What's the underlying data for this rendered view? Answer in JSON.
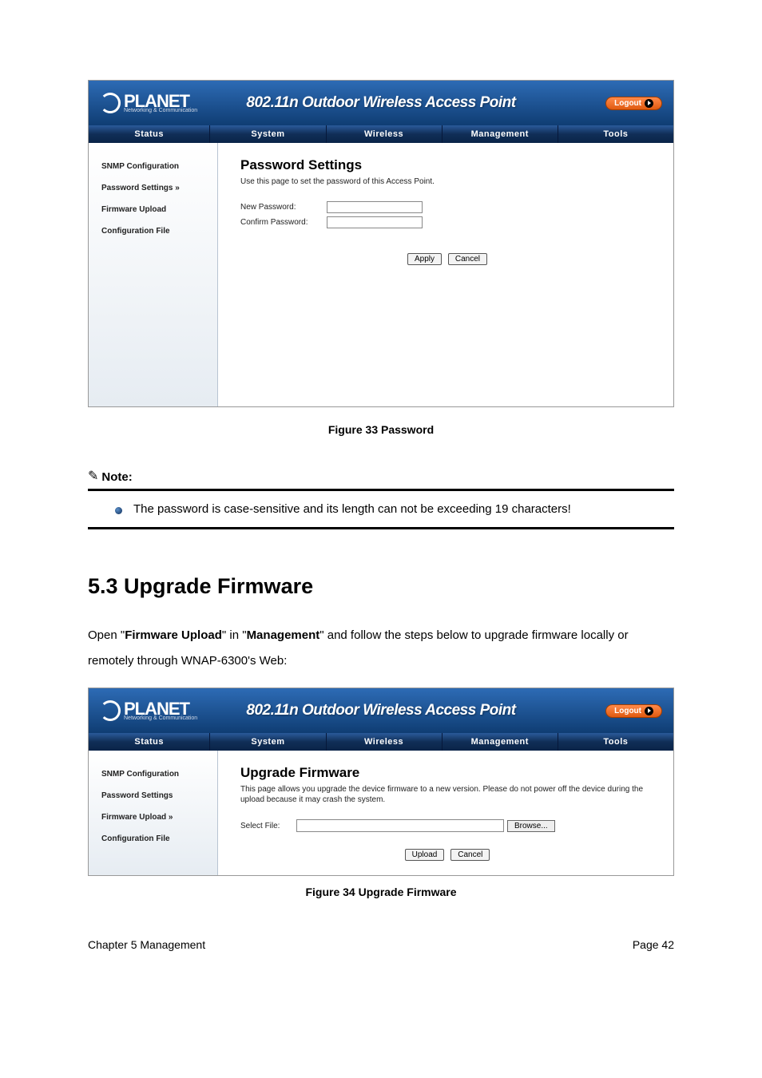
{
  "logo": {
    "brand": "PLANET",
    "sub": "Networking & Communication"
  },
  "banner": "802.11n Outdoor Wireless Access Point",
  "logout": "Logout",
  "nav": [
    "Status",
    "System",
    "Wireless",
    "Management",
    "Tools"
  ],
  "fig33": {
    "sidebar": [
      "SNMP Configuration",
      "Password Settings",
      "Firmware Upload",
      "Configuration File"
    ],
    "activeIdx": "1",
    "title": "Password Settings",
    "desc": "Use this page to set the password of this Access Point.",
    "newPw": "New Password:",
    "confirmPw": "Confirm Password:",
    "apply": "Apply",
    "cancel": "Cancel",
    "caption": "Figure 33 Password"
  },
  "note": {
    "label": "Note:",
    "text": "The password is case-sensitive and its length can not be exceeding 19 characters!"
  },
  "section": {
    "heading": "5.3 Upgrade Firmware",
    "para_a": "Open \"",
    "para_b": "Firmware Upload",
    "para_c": "\" in \"",
    "para_d": "Management",
    "para_e": "\" and follow the steps below to upgrade firmware locally or remotely through WNAP-6300's Web:"
  },
  "fig34": {
    "sidebar": [
      "SNMP Configuration",
      "Password Settings",
      "Firmware Upload",
      "Configuration File"
    ],
    "activeIdx": "2",
    "title": "Upgrade Firmware",
    "desc": "This page allows you upgrade the device firmware to a new version. Please do not power off the device during the upload because it may crash the system.",
    "selectFile": "Select File:",
    "browse": "Browse...",
    "upload": "Upload",
    "cancel": "Cancel",
    "caption": "Figure 34 Upgrade Firmware"
  },
  "footer": {
    "left": "Chapter 5 Management",
    "right": "Page 42"
  }
}
